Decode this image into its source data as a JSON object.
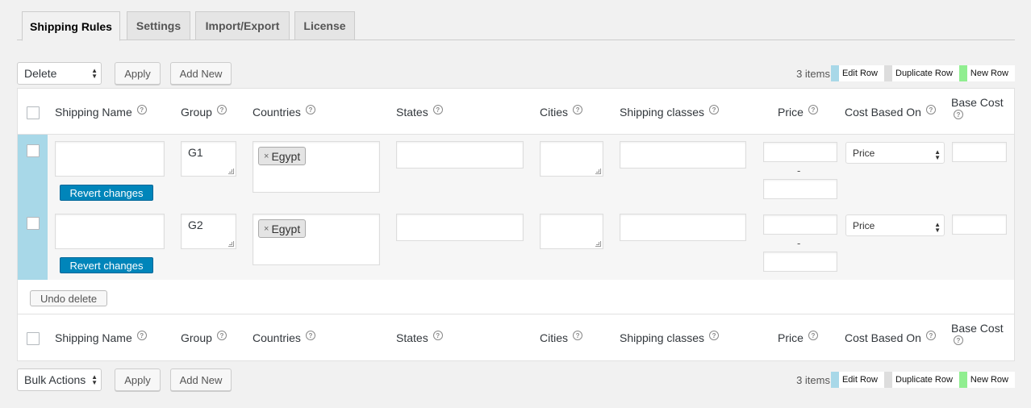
{
  "tabs": [
    {
      "label": "Shipping Rules",
      "active": true
    },
    {
      "label": "Settings"
    },
    {
      "label": "Import/Export"
    },
    {
      "label": "License"
    }
  ],
  "top_nav": {
    "action_select": "Delete",
    "apply_label": "Apply",
    "add_new_label": "Add New",
    "items_count": "3 items"
  },
  "bottom_nav": {
    "action_select": "Bulk Actions",
    "apply_label": "Apply",
    "add_new_label": "Add New",
    "items_count": "3 items"
  },
  "legend": {
    "edit_row": "Edit Row",
    "duplicate_row": "Duplicate Row",
    "new_row": "New Row",
    "colors": {
      "edit": "#a8d8e8",
      "duplicate": "#dddddd",
      "new": "#90ee90"
    }
  },
  "columns": {
    "shipping_name": "Shipping Name",
    "group": "Group",
    "countries": "Countries",
    "states": "States",
    "cities": "Cities",
    "shipping_classes": "Shipping classes",
    "price": "Price",
    "cost_based_on": "Cost Based On",
    "base_cost": "Base Cost"
  },
  "help_glyph": "?",
  "rows": [
    {
      "shipping_name": "",
      "group": "G1",
      "country_chip": "Egypt",
      "chip_remove": "×",
      "price_separator": "-",
      "cost_based_on": "Price",
      "revert_label": "Revert changes"
    },
    {
      "shipping_name": "",
      "group": "G2",
      "country_chip": "Egypt",
      "chip_remove": "×",
      "price_separator": "-",
      "cost_based_on": "Price",
      "revert_label": "Revert changes"
    }
  ],
  "undo_delete_label": "Undo delete",
  "select_arrow": "▲▼",
  "accent_color": "#0085ba"
}
